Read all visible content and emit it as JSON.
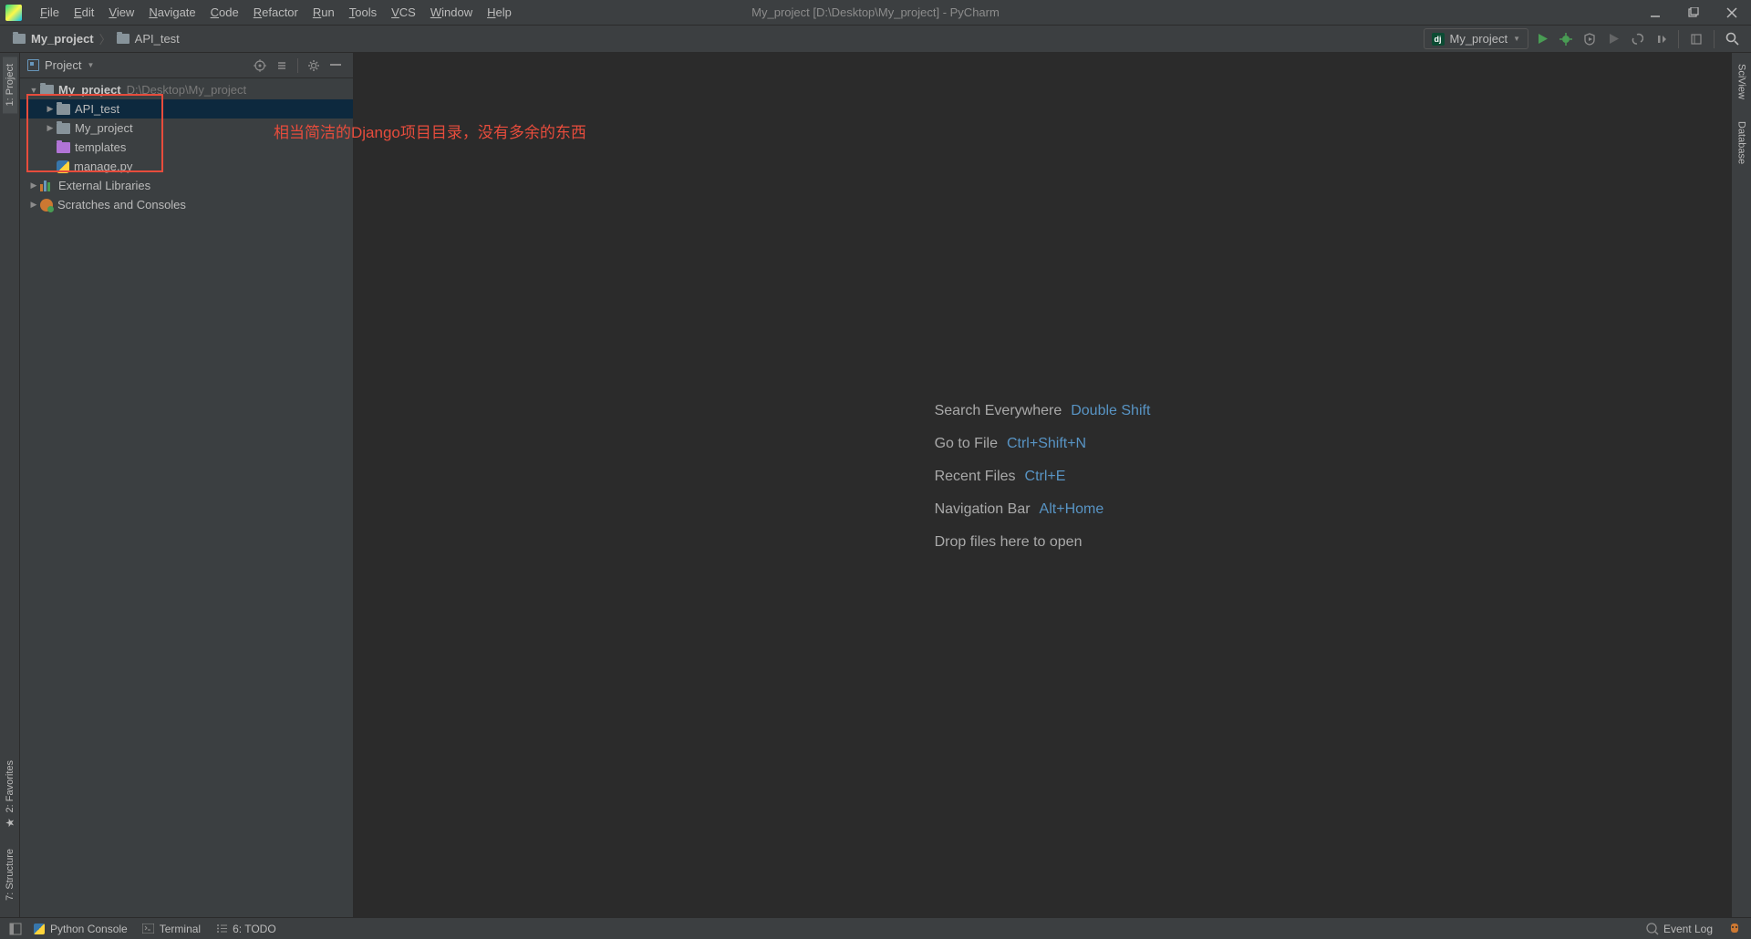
{
  "title": "My_project [D:\\Desktop\\My_project] - PyCharm",
  "menu": [
    "File",
    "Edit",
    "View",
    "Navigate",
    "Code",
    "Refactor",
    "Run",
    "Tools",
    "VCS",
    "Window",
    "Help"
  ],
  "breadcrumbs": [
    {
      "label": "My_project",
      "bold": true
    },
    {
      "label": "API_test",
      "bold": false
    }
  ],
  "run_config": {
    "label": "My_project"
  },
  "project_panel": {
    "title": "Project",
    "root": {
      "name": "My_project",
      "path": "D:\\Desktop\\My_project"
    },
    "items": [
      {
        "name": "API_test",
        "depth": 1,
        "type": "folder",
        "expandable": true,
        "selected": true
      },
      {
        "name": "My_project",
        "depth": 1,
        "type": "folder",
        "expandable": true,
        "selected": false
      },
      {
        "name": "templates",
        "depth": 1,
        "type": "folder-purple",
        "expandable": false,
        "selected": false
      },
      {
        "name": "manage.py",
        "depth": 1,
        "type": "python",
        "expandable": false,
        "selected": false
      }
    ],
    "ext_libs": "External Libraries",
    "scratches": "Scratches and Consoles"
  },
  "annotation": "相当简洁的Django项目目录，没有多余的东西",
  "kb_hints": [
    {
      "label": "Search Everywhere",
      "key": "Double Shift"
    },
    {
      "label": "Go to File",
      "key": "Ctrl+Shift+N"
    },
    {
      "label": "Recent Files",
      "key": "Ctrl+E"
    },
    {
      "label": "Navigation Bar",
      "key": "Alt+Home"
    },
    {
      "label": "Drop files here to open",
      "key": ""
    }
  ],
  "left_tabs": [
    {
      "label": "1: Project",
      "active": true
    },
    {
      "label": "7: Structure",
      "active": false
    },
    {
      "label": "2: Favorites",
      "active": false
    }
  ],
  "right_tabs": [
    {
      "label": "SciView"
    },
    {
      "label": "Database"
    }
  ],
  "statusbar": {
    "python_console": "Python Console",
    "terminal": "Terminal",
    "todo": "6: TODO",
    "event_log": "Event Log"
  }
}
